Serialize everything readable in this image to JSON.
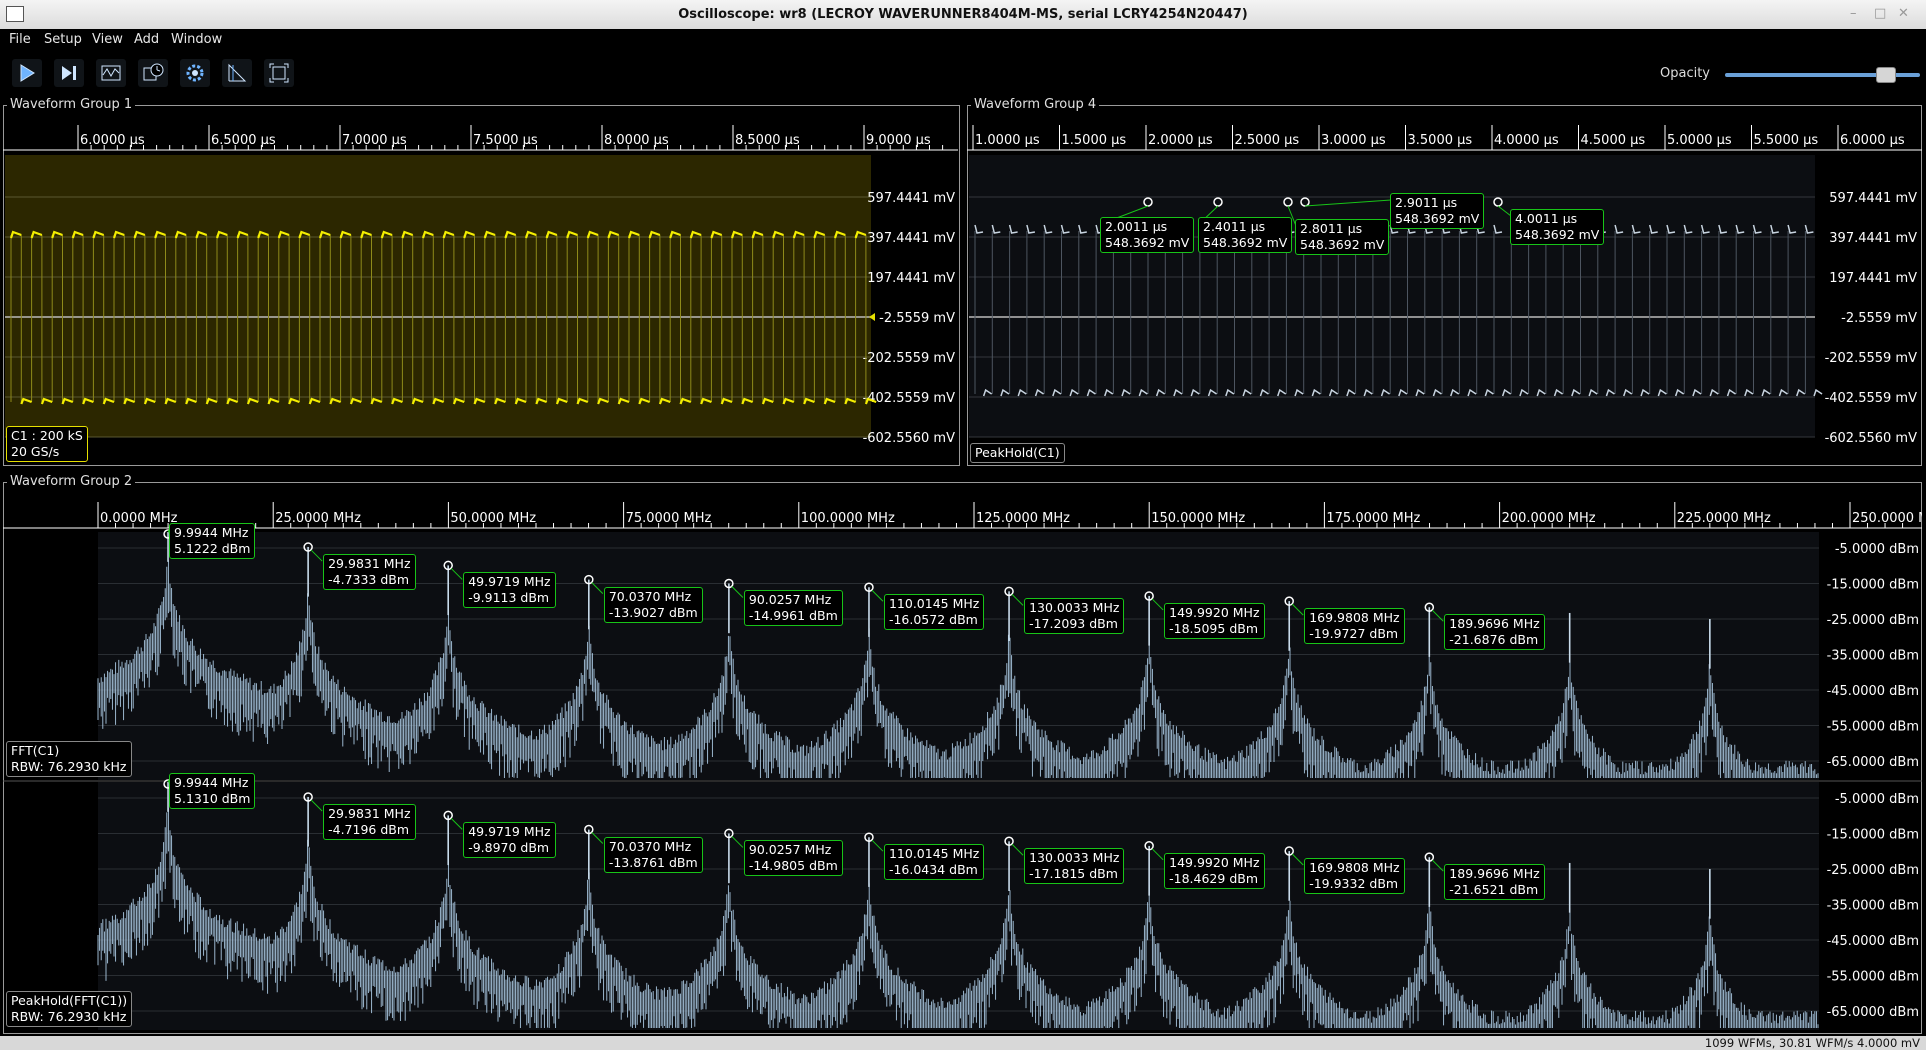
{
  "window": {
    "title": "Oscilloscope: wr8 (LECROY WAVERUNNER8404M-MS, serial LCRY4254N20447)"
  },
  "menu": [
    "File",
    "Setup",
    "View",
    "Add",
    "Window"
  ],
  "toolbar": {
    "icons": [
      "play-icon",
      "single-step-icon",
      "waveform-icon",
      "history-icon",
      "settings-gear-icon",
      "cursor-icon",
      "zoom-fit-icon"
    ],
    "opacity_label": "Opacity",
    "opacity_value": 0.82
  },
  "groups": {
    "g1": {
      "label": "Waveform Group 1",
      "x_ticks": [
        "6.0000 µs",
        "6.5000 µs",
        "7.0000 µs",
        "7.5000 µs",
        "8.0000 µs",
        "8.5000 µs",
        "9.0000 µs"
      ],
      "y_ticks": [
        "597.4441 mV",
        "397.4441 mV",
        "197.4441 mV",
        "-2.5559 mV",
        "-202.5559 mV",
        "-402.5559 mV",
        "-602.5560 mV"
      ],
      "channel": {
        "name": "C1 : 200 kS",
        "rate": "20 GS/s",
        "color": "#e6e000"
      }
    },
    "g4": {
      "label": "Waveform Group 4",
      "x_ticks": [
        "1.0000 µs",
        "1.5000 µs",
        "2.0000 µs",
        "2.5000 µs",
        "3.0000 µs",
        "3.5000 µs",
        "4.0000 µs",
        "4.5000 µs",
        "5.0000 µs",
        "5.5000 µs",
        "6.0000 µs"
      ],
      "y_ticks": [
        "597.4441 mV",
        "397.4441 mV",
        "197.4441 mV",
        "-2.5559 mV",
        "-202.5559 mV",
        "-402.5559 mV",
        "-602.5560 mV"
      ],
      "channel": {
        "name": "PeakHold(C1)",
        "color": "#c8d4e0"
      },
      "markers": [
        {
          "t": "2.0011 µs",
          "v": "548.3692 mV"
        },
        {
          "t": "2.4011 µs",
          "v": "548.3692 mV"
        },
        {
          "t": "2.8011 µs",
          "v": "548.3692 mV"
        },
        {
          "t": "2.9011 µs",
          "v": "548.3692 mV"
        },
        {
          "t": "4.0011 µs",
          "v": "548.3692 mV"
        }
      ]
    },
    "g2": {
      "label": "Waveform Group 2",
      "x_ticks": [
        "0.0000 MHz",
        "25.0000 MHz",
        "50.0000 MHz",
        "75.0000 MHz",
        "100.0000 MHz",
        "125.0000 MHz",
        "150.0000 MHz",
        "175.0000 MHz",
        "200.0000 MHz",
        "225.0000 MHz",
        "250.0000 MHz"
      ],
      "y_ticks": [
        "-5.0000 dBm",
        "-15.0000 dBm",
        "-25.0000 dBm",
        "-35.0000 dBm",
        "-45.0000 dBm",
        "-55.0000 dBm",
        "-65.0000 dBm"
      ],
      "fft": {
        "name": "FFT(C1)",
        "rbw": "RBW: 76.2930 kHz",
        "peaks": [
          {
            "f": "9.9944 MHz",
            "a": "5.1222 dBm"
          },
          {
            "f": "29.9831 MHz",
            "a": "-4.7333 dBm"
          },
          {
            "f": "49.9719 MHz",
            "a": "-9.9113 dBm"
          },
          {
            "f": "70.0370 MHz",
            "a": "-13.9027 dBm"
          },
          {
            "f": "90.0257 MHz",
            "a": "-14.9961 dBm"
          },
          {
            "f": "110.0145 MHz",
            "a": "-16.0572 dBm"
          },
          {
            "f": "130.0033 MHz",
            "a": "-17.2093 dBm"
          },
          {
            "f": "149.9920 MHz",
            "a": "-18.5095 dBm"
          },
          {
            "f": "169.9808 MHz",
            "a": "-19.9727 dBm"
          },
          {
            "f": "189.9696 MHz",
            "a": "-21.6876 dBm"
          }
        ]
      },
      "peakhold": {
        "name": "PeakHold(FFT(C1))",
        "rbw": "RBW: 76.2930 kHz",
        "peaks": [
          {
            "f": "9.9944 MHz",
            "a": "5.1310 dBm"
          },
          {
            "f": "29.9831 MHz",
            "a": "-4.7196 dBm"
          },
          {
            "f": "49.9719 MHz",
            "a": "-9.8970 dBm"
          },
          {
            "f": "70.0370 MHz",
            "a": "-13.8761 dBm"
          },
          {
            "f": "90.0257 MHz",
            "a": "-14.9805 dBm"
          },
          {
            "f": "110.0145 MHz",
            "a": "-16.0434 dBm"
          },
          {
            "f": "130.0033 MHz",
            "a": "-17.1815 dBm"
          },
          {
            "f": "149.9920 MHz",
            "a": "-18.4629 dBm"
          },
          {
            "f": "169.9808 MHz",
            "a": "-19.9332 dBm"
          },
          {
            "f": "189.9696 MHz",
            "a": "-21.6521 dBm"
          }
        ]
      }
    }
  },
  "status": "1099 WFMs, 30.81 WFM/s  4.0000 mV",
  "colors": {
    "marker_border": "#18c418",
    "trace_blue": "#a9c7e0",
    "grid": "#2a2a2a",
    "plot_bg": "#0c0e12"
  }
}
